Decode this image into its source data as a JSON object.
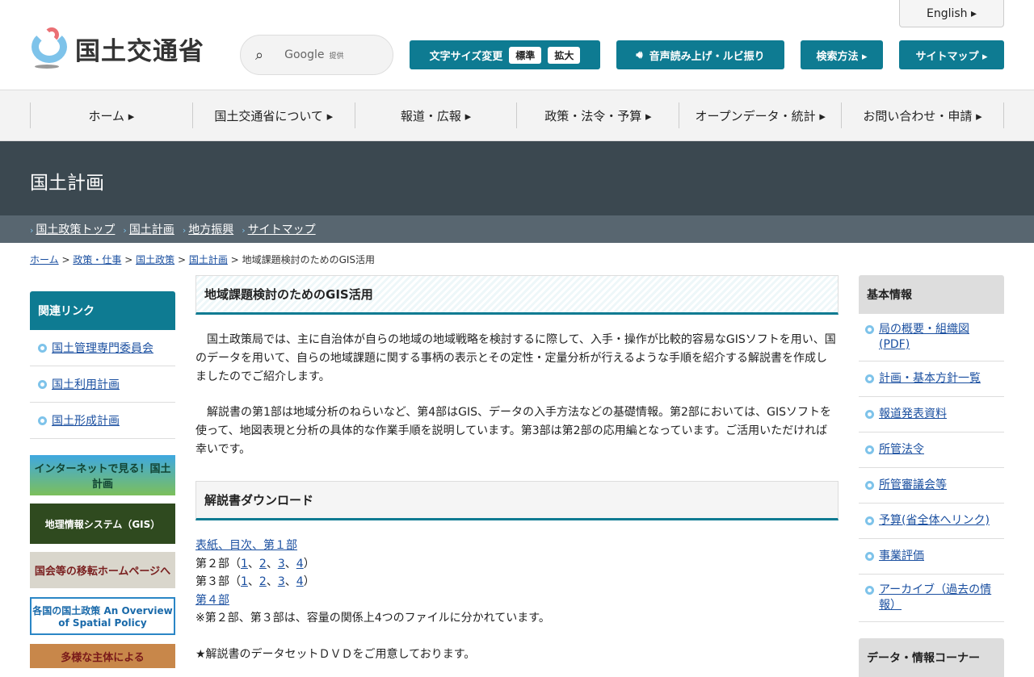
{
  "header": {
    "logo_text": "国土交通省",
    "search_label": "Google",
    "search_sub": "提供",
    "english": "English ▸",
    "text_size": "文字サイズ変更",
    "size_std": "標準",
    "size_large": "拡大",
    "speech": "音声読み上げ・ルビ振り",
    "search_method": "検索方法 ▸",
    "sitemap": "サイトマップ ▸"
  },
  "gnav": [
    "ホーム ▸",
    "国土交通省について ▸",
    "報道・広報 ▸",
    "政策・法令・予算 ▸",
    "オープンデータ・統計 ▸",
    "お問い合わせ・申請 ▸"
  ],
  "band_title": "国土計画",
  "subnav": [
    "国土政策トップ",
    "国土計画",
    "地方振興",
    "サイトマップ"
  ],
  "breadcrumb": {
    "items": [
      "ホーム",
      "政策・仕事",
      "国土政策",
      "国土計画"
    ],
    "current": "地域課題検討のためのGIS活用",
    "sep": ">"
  },
  "left": {
    "heading": "関連リンク",
    "links": [
      "国土管理専門委員会",
      "国土利用計画",
      "国土形成計画"
    ],
    "banners": [
      "インターネットで見る！国土計画",
      "地理情報システム（GIS）",
      "国会等の移転ホームページへ",
      "各国の国土政策 An Overview of Spatial Policy",
      "多様な主体による"
    ]
  },
  "main": {
    "title": "地域課題検討のためのGIS活用",
    "p1": "国土政策局では、主に自治体が自らの地域の地域戦略を検討するに際して、入手・操作が比較的容易なGISソフトを用い、国のデータを用いて、自らの地域課題に関する事柄の表示とその定性・定量分析が行えるような手順を紹介する解説書を作成しましたのでご紹介します。",
    "p2": "解説書の第1部は地域分析のねらいなど、第4部はGIS、データの入手方法などの基礎情報。第2部においては、GISソフトを使って、地図表現と分析の具体的な作業手順を説明しています。第3部は第2部の応用編となっています。ご活用いただければ幸いです。",
    "download_title": "解説書ダウンロード",
    "part1": "表紙、目次、第１部",
    "part2": "第２部",
    "part3": "第３部",
    "part4": "第４部",
    "nums": [
      "1",
      "2",
      "3",
      "4"
    ],
    "note": "※第２部、第３部は、容量の関係上4つのファイルに分かれています。",
    "dvd": "★解説書のデータセットＤＶＤをご用意しております。"
  },
  "right": {
    "heading": "基本情報",
    "links": [
      "局の概要・組織図(PDF)",
      "計画・基本方針一覧",
      "報道発表資料",
      "所管法令",
      "所管審議会等",
      "予算(省全体へリンク)",
      "事業評価",
      "アーカイブ（過去の情報）"
    ],
    "heading2": "データ・情報コーナー"
  }
}
